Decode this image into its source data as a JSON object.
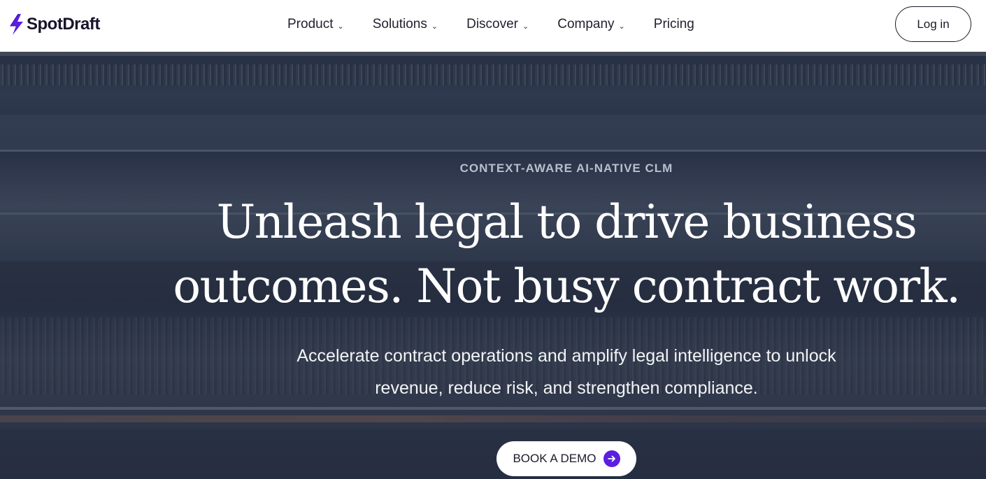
{
  "brand": {
    "name": "SpotDraft",
    "logo_icon": "lightning-bolt-icon",
    "accent_color": "#5a1fe0"
  },
  "nav": {
    "items": [
      {
        "label": "Product",
        "has_dropdown": true
      },
      {
        "label": "Solutions",
        "has_dropdown": true
      },
      {
        "label": "Discover",
        "has_dropdown": true
      },
      {
        "label": "Company",
        "has_dropdown": true
      },
      {
        "label": "Pricing",
        "has_dropdown": false
      }
    ],
    "login_label": "Log in"
  },
  "hero": {
    "eyebrow": "CONTEXT-AWARE AI-NATIVE CLM",
    "headline_line1": "Unleash legal to drive business",
    "headline_line2": "outcomes. Not busy contract work.",
    "subtext_line1": "Accelerate contract operations and amplify legal intelligence to unlock",
    "subtext_line2": "revenue, reduce risk, and strengthen compliance.",
    "cta_label": "BOOK A DEMO",
    "cta_icon": "arrow-right-icon"
  }
}
